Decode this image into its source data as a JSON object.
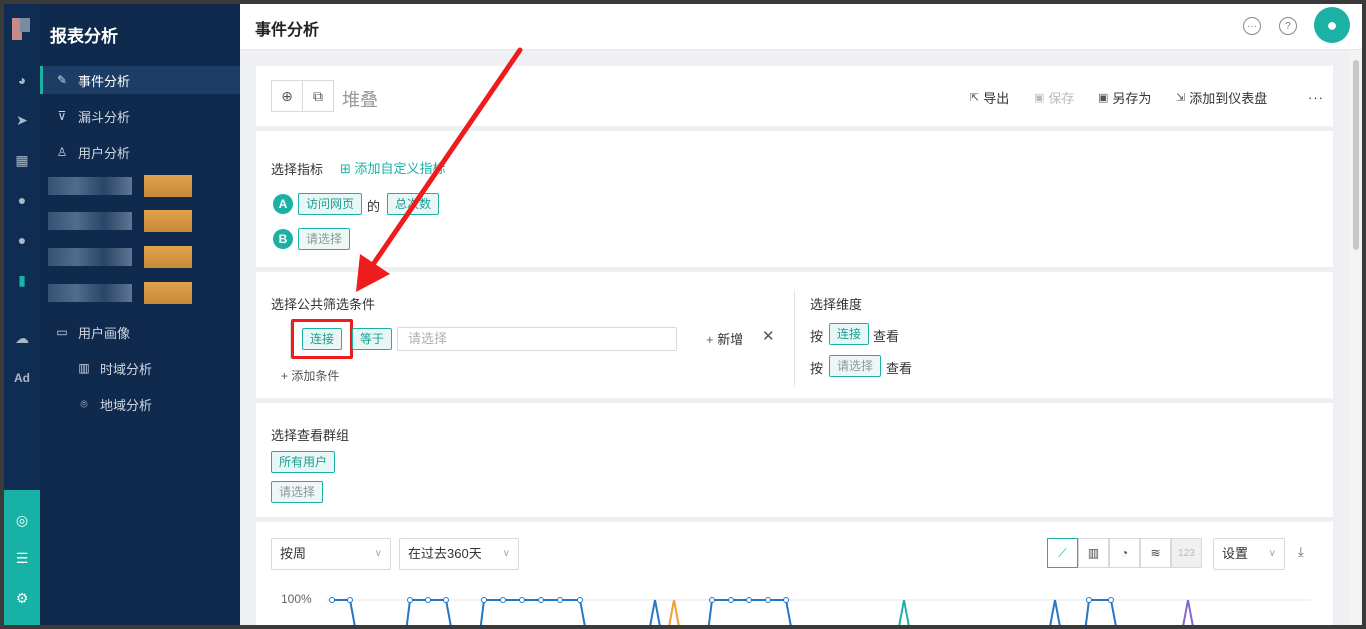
{
  "header": {
    "title": "事件分析"
  },
  "nav": {
    "title": "报表分析",
    "items": [
      {
        "label": "事件分析",
        "icon": "edit-icon"
      },
      {
        "label": "漏斗分析",
        "icon": "funnel-icon"
      },
      {
        "label": "用户分析",
        "icon": "user-icon"
      },
      {
        "label": "用户画像",
        "icon": "folder-icon"
      },
      {
        "label": "时域分析",
        "icon": "bar-chart-icon"
      },
      {
        "label": "地域分析",
        "icon": "location-icon"
      }
    ]
  },
  "rail": {
    "ad_label": "Ad"
  },
  "toolbar": {
    "chart_name": "堆叠",
    "export": "导出",
    "save": "保存",
    "save_as": "另存为",
    "add_dashboard": "添加到仪表盘",
    "more": "···"
  },
  "metrics": {
    "label": "选择指标",
    "add_custom": "添加自定义指标",
    "a": {
      "letter": "A",
      "event": "访问网页",
      "of": "的",
      "measure": "总次数"
    },
    "b": {
      "letter": "B",
      "placeholder": "请选择"
    }
  },
  "filter": {
    "label": "选择公共筛选条件",
    "field": "连接",
    "operator": "等于",
    "value_placeholder": "请选择",
    "add_new": "新增",
    "add_condition": "添加条件"
  },
  "dimension": {
    "label": "选择维度",
    "row1": {
      "prefix": "按",
      "value": "连接",
      "suffix": "查看"
    },
    "row2": {
      "prefix": "按",
      "value": "请选择",
      "suffix": "查看"
    }
  },
  "group": {
    "label": "选择查看群组",
    "all_users": "所有用户",
    "placeholder": "请选择"
  },
  "chart_controls": {
    "period": "按周",
    "range": "在过去360天",
    "number_btn": "123",
    "settings": "设置"
  },
  "chart_data": {
    "type": "line",
    "y_tick": "100%",
    "series": [
      {
        "color": "#1f78c8"
      },
      {
        "color": "#f0a030"
      },
      {
        "color": "#20b0a8"
      },
      {
        "color": "#8866cc"
      }
    ]
  },
  "colors": {
    "accent": "#1bb1a5",
    "nav_bg": "#0f2a4d",
    "highlight": "#ee1c1c"
  }
}
